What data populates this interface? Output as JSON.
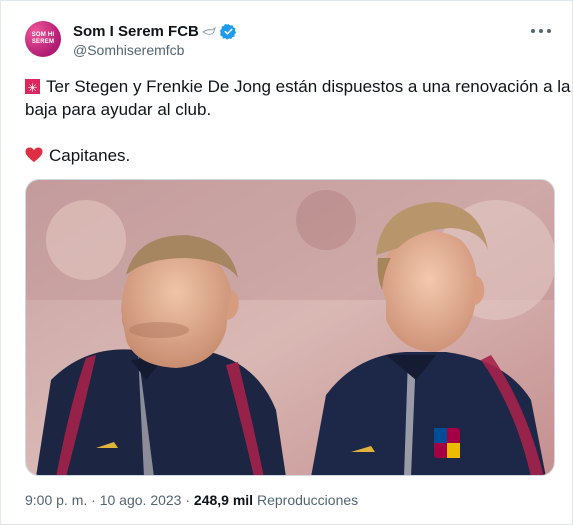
{
  "author": {
    "display_name": "Som I Serem FCB",
    "handle": "@Somhiseremfcb",
    "avatar_text_line1": "SOM HI",
    "avatar_text_line2": "SEREM",
    "verified": true
  },
  "tweet": {
    "line1": "Ter Stegen y Frenkie De Jong están dispuestos a una renovación a la",
    "line2": "baja para ayudar al club.",
    "line3": "Capitanes."
  },
  "meta": {
    "time": "9:00 p. m.",
    "separator": " · ",
    "date": "10 ago. 2023",
    "views": "248,9 mil",
    "views_label": "Reproducciones"
  },
  "colors": {
    "text": "#0f1419",
    "secondary": "#536471",
    "verified": "#1d9bf0",
    "avatar": "#d8338a"
  }
}
